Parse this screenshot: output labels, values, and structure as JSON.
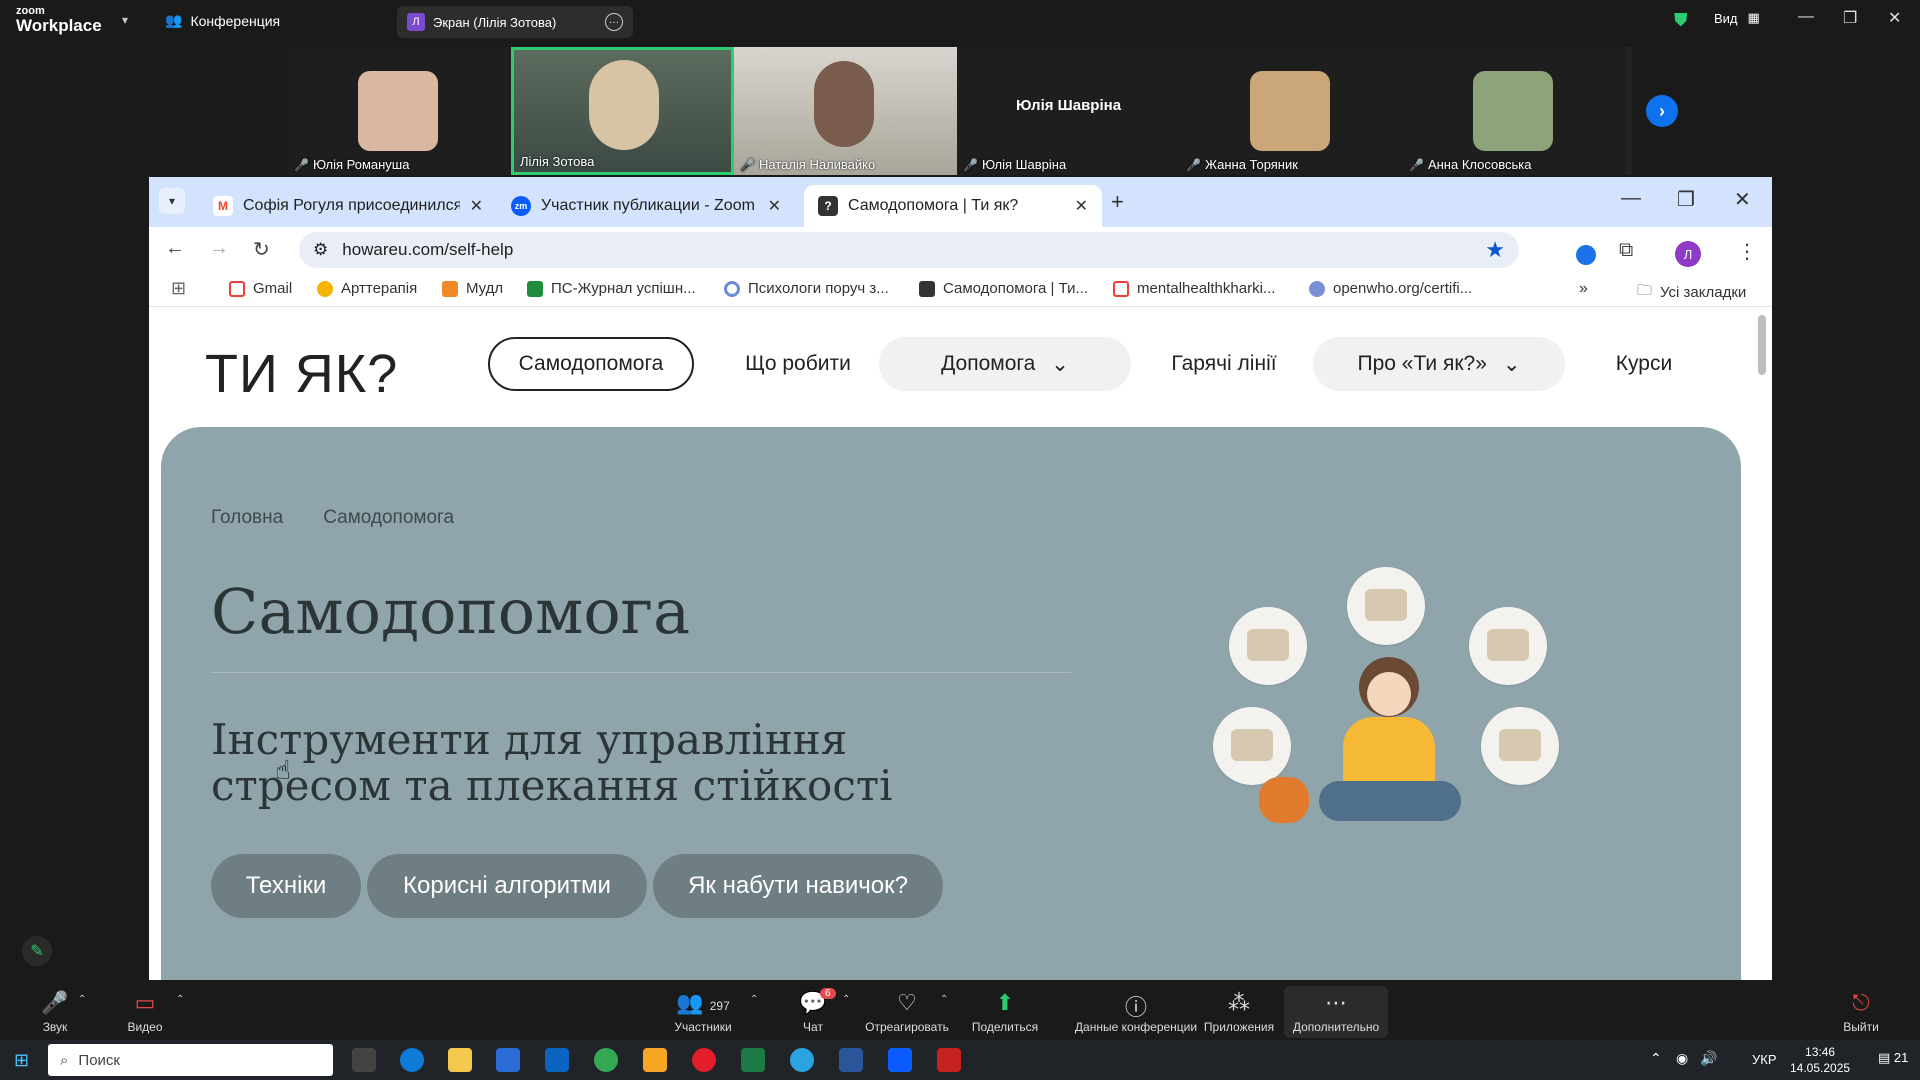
{
  "zoom": {
    "logo_small": "zoom",
    "logo_big": "Workplace",
    "conference_label": "Конференция",
    "screen_share_label": "Экран (Лілія Зотова)",
    "screen_share_badge": "Л",
    "view_label": "Вид"
  },
  "gallery": {
    "participants": [
      {
        "name": "Юлія Романуша"
      },
      {
        "name": "Лілія Зотова"
      },
      {
        "name": "Наталія Наливайко"
      },
      {
        "name": "Юлія Шавріна",
        "center_label": "Юлія Шавріна"
      },
      {
        "name": "Жанна Торяник"
      },
      {
        "name": "Анна Клосовська"
      }
    ]
  },
  "chrome": {
    "tabs": [
      {
        "title": "Софія Рогуля присоединился(",
        "favicon": "M",
        "color": "#ea4335"
      },
      {
        "title": "Участник публикации - Zoom",
        "favicon": "zm",
        "color": "#0b5cff"
      },
      {
        "title": "Самодопомога | Ти як?",
        "favicon": "?",
        "color": "#333333"
      }
    ],
    "url": "howareu.com/self-help",
    "bookmarks": [
      {
        "label": "Gmail"
      },
      {
        "label": "Арттерапія"
      },
      {
        "label": "Мудл"
      },
      {
        "label": "ПС-Журнал успішн..."
      },
      {
        "label": "Психологи поруч з..."
      },
      {
        "label": "Самодопомога | Ти..."
      },
      {
        "label": "mentalhealthkharki..."
      },
      {
        "label": "openwho.org/certifi..."
      }
    ],
    "all_bookmarks": "Усі закладки",
    "profile_letter": "Л"
  },
  "site": {
    "logo": "ТИ ЯК?",
    "nav": {
      "self_help": "Самодопомога",
      "what_to_do": "Що робити",
      "help": "Допомога",
      "hotlines": "Гарячі лінії",
      "about": "Про «Ти як?»",
      "courses": "Курси"
    },
    "breadcrumbs": {
      "home": "Головна",
      "current": "Самодопомога"
    },
    "title": "Самодопомога",
    "subtitle": "Інструменти для управління стресом та плекання стійкості",
    "buttons": {
      "techniques": "Техніки",
      "algorithms": "Корисні алгоритми",
      "skills": "Як набути навичок?"
    }
  },
  "zoom_controls": {
    "audio": "Звук",
    "video": "Видео",
    "participants": "Участники",
    "participants_count": "297",
    "chat": "Чат",
    "chat_badge": "6",
    "react": "Отреагировать",
    "share": "Поделиться",
    "info": "Данные конференции",
    "apps": "Приложения",
    "more": "Дополнительно",
    "leave": "Выйти"
  },
  "taskbar": {
    "search_placeholder": "Поиск",
    "lang": "УКР",
    "time": "13:46",
    "date": "14.05.2025",
    "notif_count": "21"
  },
  "colors": {
    "hero_bg": "#8fa5ab",
    "zoom_green": "#2ecc71",
    "zoom_blue": "#0e72ed"
  }
}
